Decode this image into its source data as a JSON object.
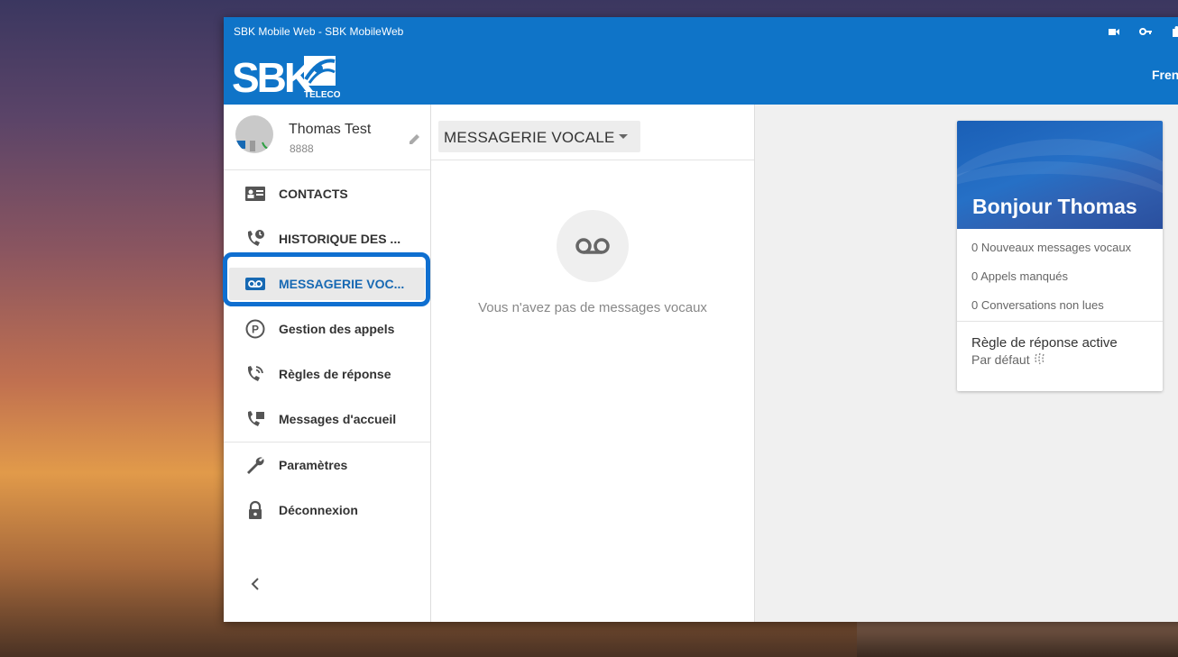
{
  "window": {
    "title": "SBK Mobile Web - SBK MobileWeb",
    "language_label": "Fren"
  },
  "brand": {
    "logo_text": "SBK",
    "logo_subtext": "TELECOM",
    "primary_color": "#0f74c8"
  },
  "profile": {
    "name": "Thomas Test",
    "number": "8888"
  },
  "sidebar": {
    "items": [
      {
        "label": "CONTACTS",
        "icon": "contact-card-icon"
      },
      {
        "label": "HISTORIQUE DES ...",
        "icon": "call-history-icon"
      },
      {
        "label": "MESSAGERIE VOC...",
        "icon": "voicemail-icon",
        "active": true
      },
      {
        "label": "Gestion des appels",
        "icon": "parking-icon"
      },
      {
        "label": "Règles de réponse",
        "icon": "phone-ring-icon"
      },
      {
        "label": "Messages d'accueil",
        "icon": "phone-greeting-icon"
      },
      {
        "label": "Paramètres",
        "icon": "wrench-icon"
      },
      {
        "label": "Déconnexion",
        "icon": "lock-icon"
      }
    ]
  },
  "voicemail": {
    "dropdown_label": "MESSAGERIE VOCALE",
    "empty_message": "Vous n'avez pas de messages vocaux"
  },
  "summary_card": {
    "greeting": "Bonjour Thomas",
    "stats": [
      "0 Nouveaux messages vocaux",
      "0 Appels manqués",
      "0 Conversations non lues"
    ],
    "rule_title": "Règle de réponse active",
    "rule_value": "Par défaut"
  }
}
